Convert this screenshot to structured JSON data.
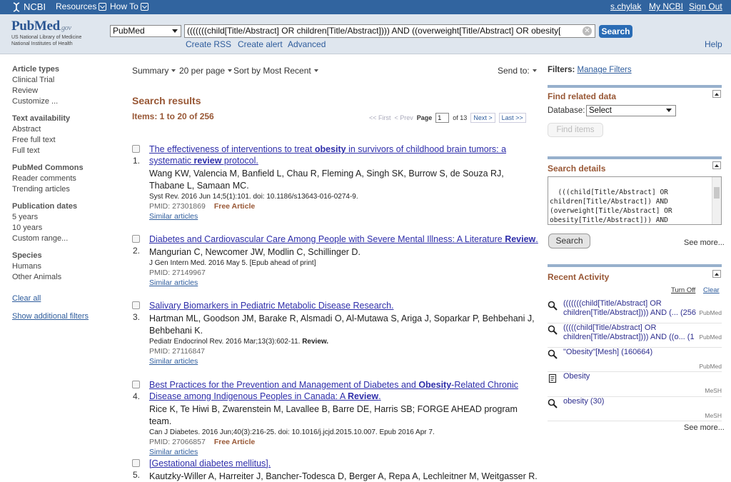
{
  "ncbi_bar": {
    "logo": "NCBI",
    "menus": [
      "Resources",
      "How To"
    ],
    "user_links": [
      "s.chylak",
      "My NCBI",
      "Sign Out"
    ]
  },
  "header": {
    "logo_word": "PubMed",
    "logo_suffix": ".gov",
    "logo_sub1": "US National Library of Medicine",
    "logo_sub2": "National Institutes of Health",
    "db_selected": "PubMed",
    "query": "(((((((child[Title/Abstract] OR children[Title/Abstract]))) AND ((overweight[Title/Abstract] OR obesity[",
    "search_label": "Search",
    "links": [
      "Create RSS",
      "Create alert",
      "Advanced"
    ],
    "help": "Help"
  },
  "left_filters": {
    "groups": [
      {
        "heading": "Article types",
        "items": [
          "Clinical Trial",
          "Review",
          "Customize ..."
        ]
      },
      {
        "heading": "Text availability",
        "items": [
          "Abstract",
          "Free full text",
          "Full text"
        ]
      },
      {
        "heading": "PubMed Commons",
        "items": [
          "Reader comments",
          "Trending articles"
        ]
      },
      {
        "heading": "Publication dates",
        "items": [
          "5 years",
          "10 years",
          "Custom range..."
        ]
      },
      {
        "heading": "Species",
        "items": [
          "Humans",
          "Other Animals"
        ]
      }
    ],
    "clear_all": "Clear all",
    "show_additional": "Show additional filters"
  },
  "toolbar": {
    "summary": "Summary",
    "per_page": "20 per page",
    "sort": "Sort by Most Recent",
    "send_to": "Send to:"
  },
  "results": {
    "title": "Search results",
    "items": "Items: 1 to 20 of 256",
    "pager": {
      "first": "<< First",
      "prev": "< Prev",
      "page_label": "Page",
      "page_value": "1",
      "of": "of 13",
      "next": "Next >",
      "last": "Last >>"
    },
    "list": [
      {
        "num": "1.",
        "title_parts": [
          [
            "The effectiveness of interventions to treat ",
            false
          ],
          [
            "obesity",
            true
          ],
          [
            " in survivors of childhood brain tumors: a systematic ",
            false
          ],
          [
            "review",
            true
          ],
          [
            " protocol.",
            false
          ]
        ],
        "authors": "Wang KW, Valencia M, Banfield L, Chau R, Fleming A, Singh SK, Burrow S, de Souza RJ, Thabane L, Samaan MC.",
        "cite": "Syst Rev. 2016 Jun 14;5(1):101. doi: 10.1186/s13643-016-0274-9.",
        "cite_tag": "",
        "pmid": "PMID: 27301869",
        "free": "Free Article",
        "similar": "Similar articles"
      },
      {
        "num": "2.",
        "title_parts": [
          [
            "Diabetes and Cardiovascular Care Among People with Severe Mental Illness: A Literature ",
            false
          ],
          [
            "Review",
            true
          ],
          [
            ".",
            false
          ]
        ],
        "authors": "Mangurian C, Newcomer JW, Modlin C, Schillinger D.",
        "cite": "J Gen Intern Med. 2016 May 5. [Epub ahead of print]",
        "cite_tag": "",
        "pmid": "PMID: 27149967",
        "free": "",
        "similar": "Similar articles"
      },
      {
        "num": "3.",
        "title_parts": [
          [
            "Salivary Biomarkers in Pediatric Metabolic Disease Research.",
            false
          ]
        ],
        "authors": "Hartman ML, Goodson JM, Barake R, Alsmadi O, Al-Mutawa S, Ariga J, Soparkar P, Behbehani J, Behbehani K.",
        "cite": "Pediatr Endocrinol Rev. 2016 Mar;13(3):602-11. ",
        "cite_tag": "Review.",
        "pmid": "PMID: 27116847",
        "free": "",
        "similar": "Similar articles"
      },
      {
        "num": "4.",
        "title_parts": [
          [
            "Best Practices for the Prevention and Management of Diabetes and ",
            false
          ],
          [
            "Obesity",
            true
          ],
          [
            "-Related Chronic Disease among Indigenous Peoples in Canada: A ",
            false
          ],
          [
            "Review",
            true
          ],
          [
            ".",
            false
          ]
        ],
        "authors": "Rice K, Te Hiwi B, Zwarenstein M, Lavallee B, Barre DE, Harris SB; FORGE AHEAD program team.",
        "cite": "Can J Diabetes. 2016 Jun;40(3):216-25. doi: 10.1016/j.jcjd.2015.10.007. Epub 2016 Apr 7.",
        "cite_tag": "",
        "pmid": "PMID: 27066857",
        "free": "Free Article",
        "similar": "Similar articles"
      },
      {
        "num": "5.",
        "title_parts": [
          [
            "[Gestational diabetes mellitus].",
            false
          ]
        ],
        "authors": "Kautzky-Willer A, Harreiter J, Bancher-Todesca D, Berger A, Repa A, Lechleitner M, Weitgasser R.",
        "cite": "",
        "cite_tag": "",
        "pmid": "",
        "free": "",
        "similar": ""
      }
    ]
  },
  "right": {
    "filters_label": "Filters:",
    "manage_filters": "Manage Filters",
    "find_related": {
      "heading": "Find related data",
      "db_label": "Database:",
      "db_value": "Select",
      "button": "Find items"
    },
    "search_details": {
      "heading": "Search details",
      "text": "(((child[Title/Abstract] OR\nchildren[Title/Abstract]) AND\n(overweight[Title/Abstract] OR\nobesity[Title/Abstract])) AND\nscreening[Title/Abstract]) AND",
      "button": "Search",
      "see_more": "See more..."
    },
    "recent_activity": {
      "heading": "Recent Activity",
      "turn_off": "Turn Off",
      "clear": "Clear",
      "items": [
        {
          "icon": "search-icon",
          "line1": "(((((((child[Title/Abstract] OR",
          "line2": "children[Title/Abstract]))) AND (... (256",
          "db": "PubMed"
        },
        {
          "icon": "search-icon",
          "line1": "(((((child[Title/Abstract] OR",
          "line2": "children[Title/Abstract]))) AND ((o... (1",
          "db": "PubMed"
        },
        {
          "icon": "search-icon",
          "line1": "\"Obesity\"[Mesh] (160664)",
          "line2": "",
          "db": "PubMed"
        },
        {
          "icon": "document-icon",
          "line1": "Obesity",
          "line2": "",
          "db": "MeSH"
        },
        {
          "icon": "search-icon",
          "line1": "obesity (30)",
          "line2": "",
          "db": "MeSH"
        }
      ],
      "see_more": "See more..."
    }
  },
  "colors": {
    "ncbi_bar": "#31649f",
    "header_bg": "#dfe6ee",
    "accent_brown": "#985735",
    "link_blue": "#2e5c9c",
    "title_link": "#2e2eaa",
    "search_button": "#2a6cb5"
  }
}
